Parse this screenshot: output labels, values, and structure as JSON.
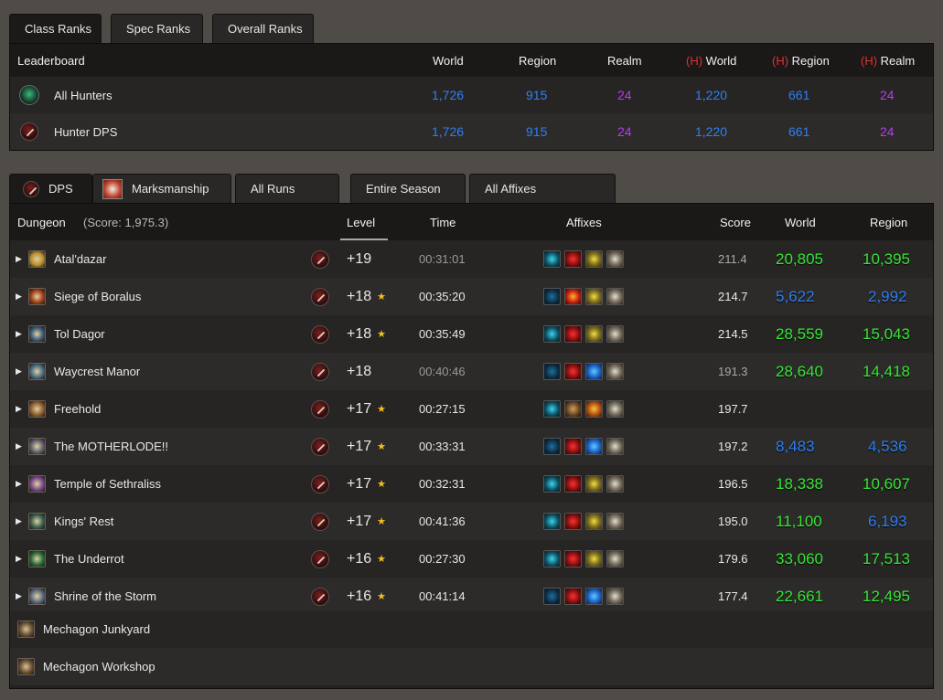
{
  "class_tabs": [
    "Class Ranks",
    "Spec Ranks",
    "Overall Ranks"
  ],
  "leaderboard": {
    "headers": {
      "name": "Leaderboard",
      "world": "World",
      "region": "Region",
      "realm": "Realm",
      "h_prefix": "(H)",
      "h_world": "World",
      "h_region": "Region",
      "h_realm": "Realm"
    },
    "rows": [
      {
        "name": "All Hunters",
        "icon": "hunter-class-icon",
        "world": "1,726",
        "region": "915",
        "realm": "24",
        "h_world": "1,220",
        "h_region": "661",
        "h_realm": "24"
      },
      {
        "name": "Hunter DPS",
        "icon": "dps-role-icon",
        "world": "1,726",
        "region": "915",
        "realm": "24",
        "h_world": "1,220",
        "h_region": "661",
        "h_realm": "24"
      }
    ]
  },
  "filter_tabs": [
    "DPS",
    "Marksmanship",
    "All Runs",
    "Entire Season",
    "All Affixes"
  ],
  "runs": {
    "headers": {
      "dungeon": "Dungeon",
      "score_label": "(Score: 1,975.3)",
      "level": "Level",
      "time": "Time",
      "affixes": "Affixes",
      "score": "Score",
      "world": "World",
      "region": "Region"
    },
    "rows": [
      {
        "name": "Atal'dazar",
        "level": "+19",
        "star": false,
        "time": "00:31:01",
        "timed": false,
        "affixes": [
          "teal",
          "red",
          "yellow",
          "gray"
        ],
        "score": "211.4",
        "world": "20,805",
        "world_color": "green",
        "region": "10,395",
        "region_color": "green"
      },
      {
        "name": "Siege of Boralus",
        "level": "+18",
        "star": true,
        "time": "00:35:20",
        "timed": true,
        "affixes": [
          "teal2",
          "redfire",
          "yellow",
          "gray"
        ],
        "score": "214.7",
        "world": "5,622",
        "world_color": "blue",
        "region": "2,992",
        "region_color": "blue"
      },
      {
        "name": "Tol Dagor",
        "level": "+18",
        "star": true,
        "time": "00:35:49",
        "timed": true,
        "affixes": [
          "teal",
          "red",
          "yellow",
          "gray"
        ],
        "score": "214.5",
        "world": "28,559",
        "world_color": "green",
        "region": "15,043",
        "region_color": "green"
      },
      {
        "name": "Waycrest Manor",
        "level": "+18",
        "star": false,
        "time": "00:40:46",
        "timed": false,
        "affixes": [
          "teal2",
          "red",
          "blue",
          "gray"
        ],
        "score": "191.3",
        "world": "28,640",
        "world_color": "green",
        "region": "14,418",
        "region_color": "green"
      },
      {
        "name": "Freehold",
        "level": "+17",
        "star": true,
        "time": "00:27:15",
        "timed": true,
        "affixes": [
          "teal",
          "brown",
          "orange",
          "gray"
        ],
        "score": "197.7",
        "world": "",
        "world_color": "green",
        "region": "",
        "region_color": "green"
      },
      {
        "name": "The MOTHERLODE!!",
        "level": "+17",
        "star": true,
        "time": "00:33:31",
        "timed": true,
        "affixes": [
          "teal2",
          "red",
          "blue",
          "gray"
        ],
        "score": "197.2",
        "world": "8,483",
        "world_color": "blue",
        "region": "4,536",
        "region_color": "blue"
      },
      {
        "name": "Temple of Sethraliss",
        "level": "+17",
        "star": true,
        "time": "00:32:31",
        "timed": true,
        "affixes": [
          "teal",
          "red",
          "yellow",
          "gray"
        ],
        "score": "196.5",
        "world": "18,338",
        "world_color": "green",
        "region": "10,607",
        "region_color": "green"
      },
      {
        "name": "Kings' Rest",
        "level": "+17",
        "star": true,
        "time": "00:41:36",
        "timed": true,
        "affixes": [
          "teal",
          "red",
          "yellow",
          "gray"
        ],
        "score": "195.0",
        "world": "11,100",
        "world_color": "green",
        "region": "6,193",
        "region_color": "blue"
      },
      {
        "name": "The Underrot",
        "level": "+16",
        "star": true,
        "time": "00:27:30",
        "timed": true,
        "affixes": [
          "teal",
          "red",
          "yellow",
          "gray"
        ],
        "score": "179.6",
        "world": "33,060",
        "world_color": "green",
        "region": "17,513",
        "region_color": "green"
      },
      {
        "name": "Shrine of the Storm",
        "level": "+16",
        "star": true,
        "time": "00:41:14",
        "timed": true,
        "affixes": [
          "teal2",
          "red",
          "blue",
          "gray"
        ],
        "score": "177.4",
        "world": "22,661",
        "world_color": "green",
        "region": "12,495",
        "region_color": "green"
      }
    ],
    "extra_rows": [
      "Mechagon Junkyard",
      "Mechagon Workshop"
    ]
  },
  "colors": {
    "green": "#37e637",
    "blue": "#2f7ff0",
    "purple": "#b43cf0",
    "heroic_red": "#e03030",
    "star": "#f0c020"
  },
  "dungeon_icon_colors": [
    "#b89030",
    "#a04018",
    "#3a5a78",
    "#4a6a80",
    "#906030",
    "#606070",
    "#7a4a8a",
    "#3a6050",
    "#2a6a3a",
    "#5a6a80"
  ]
}
